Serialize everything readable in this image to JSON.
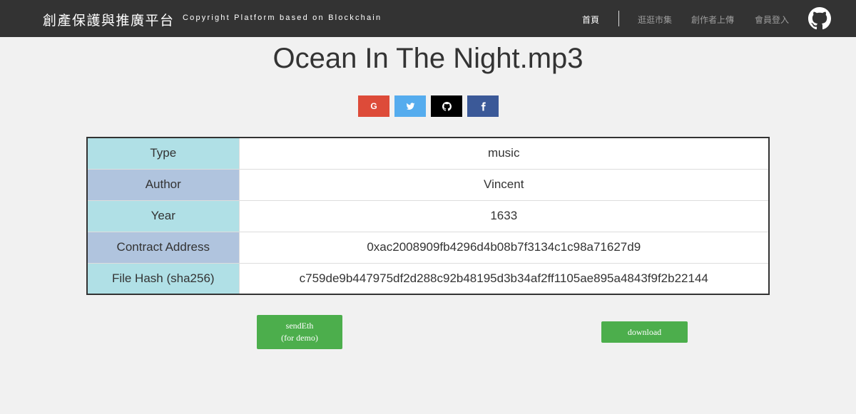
{
  "navbar": {
    "brand": "創產保護與推廣平台",
    "tagline": "Copyright Platform based on Blockchain",
    "links": [
      "首頁",
      "逛逛市集",
      "創作者上傳",
      "會員登入"
    ],
    "github_icon": "github-icon"
  },
  "page": {
    "title": "Ocean In The Night.mp3"
  },
  "share": {
    "google_label": "G",
    "google_icon": "google-icon",
    "twitter_icon": "twitter-icon",
    "github_icon": "github-icon",
    "facebook_icon": "facebook-icon",
    "colors": {
      "google": "#dd4b39",
      "twitter": "#55acee",
      "github": "#000000",
      "facebook": "#3b5998"
    }
  },
  "details": {
    "rows": [
      {
        "key": "Type",
        "value": "music"
      },
      {
        "key": "Author",
        "value": "Vincent"
      },
      {
        "key": "Year",
        "value": "1633"
      },
      {
        "key": "Contract Address",
        "value": "0xac2008909fb4296d4b08b7f3134c1c98a71627d9"
      },
      {
        "key": "File Hash (sha256)",
        "value": "c759de9b447975df2d288c92b48195d3b34af2ff1105ae895a4843f9f2b22144"
      }
    ],
    "key_colors": [
      "#b0e0e6",
      "#b0c4de"
    ]
  },
  "actions": {
    "send_label_line1": "sendEth",
    "send_label_line2": "(for demo)",
    "download_label": "download",
    "button_color": "#4cae4c"
  }
}
